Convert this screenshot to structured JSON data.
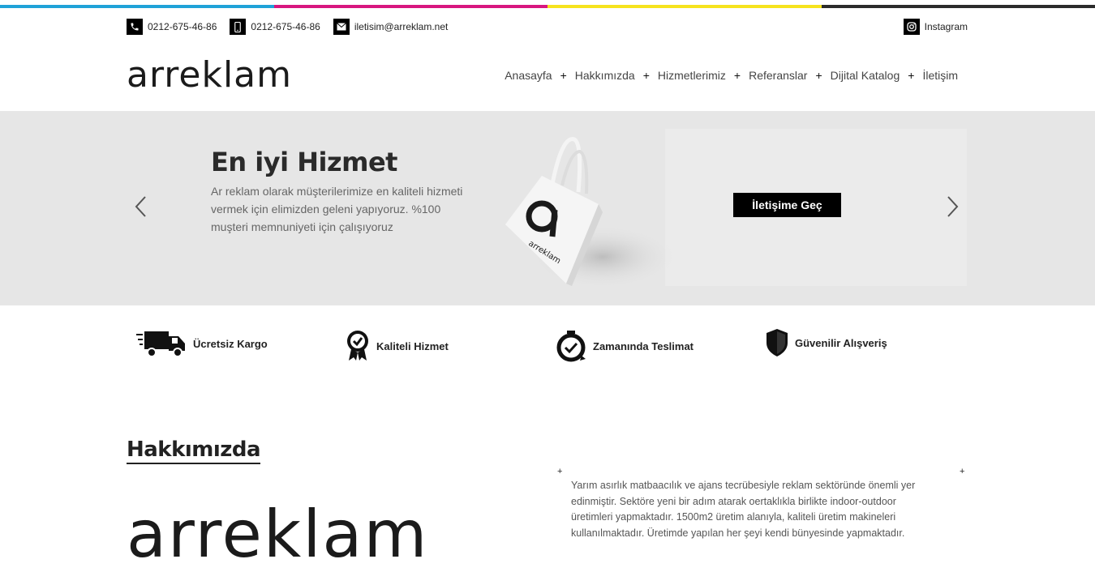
{
  "colors": {
    "cyan": "#1fa2d8",
    "magenta": "#d8167f",
    "yellow": "#f6e31d",
    "black": "#2b2b2b"
  },
  "topbar": {
    "phone1": "0212-675-46-86",
    "phone1_icon": "phone-icon",
    "phone2": "0212-675-46-86",
    "phone2_icon": "mobile-phone-icon",
    "email": "iletisim@arreklam.net",
    "email_icon": "mail-icon",
    "instagram": "Instagram",
    "instagram_icon": "instagram-icon"
  },
  "header": {
    "logo": "arreklam",
    "nav": [
      "Anasayfa",
      "Hakkımızda",
      "Hizmetlerimiz",
      "Referanslar",
      "Dijital Katalog",
      "İletişim"
    ]
  },
  "hero": {
    "title": "En iyi Hizmet",
    "text": "Ar reklam olarak müşterilerimize en kaliteli hizmeti vermek için elimizden geleni yapıyoruz. %100 muşteri memnuniyeti için çalışıyoruz",
    "cta": "İletişime Geç",
    "bag_logo": "arreklam"
  },
  "features": [
    {
      "label": "Ücretsiz Kargo",
      "icon": "truck-icon"
    },
    {
      "label": "Kaliteli Hizmet",
      "icon": "quality-badge-icon"
    },
    {
      "label": "Zamanında Teslimat",
      "icon": "stopwatch-icon"
    },
    {
      "label": "Güvenilir Alışveriş",
      "icon": "shield-icon"
    }
  ],
  "about": {
    "title": "Hakkımızda",
    "logo": "arreklam",
    "text": "Yarım asırlık matbaacılık ve ajans tecrübesiyle reklam sektöründe önemli yer edinmiştir. Sektöre yeni bir adım atarak oertaklıkla birlikte indoor-outdoor üretimleri yapmaktadır. 1500m2 üretim alanıyla, kaliteli üretim makineleri kullanılmaktadır. Üretimde yapılan her şeyi kendi bünyesinde yapmaktadır."
  }
}
